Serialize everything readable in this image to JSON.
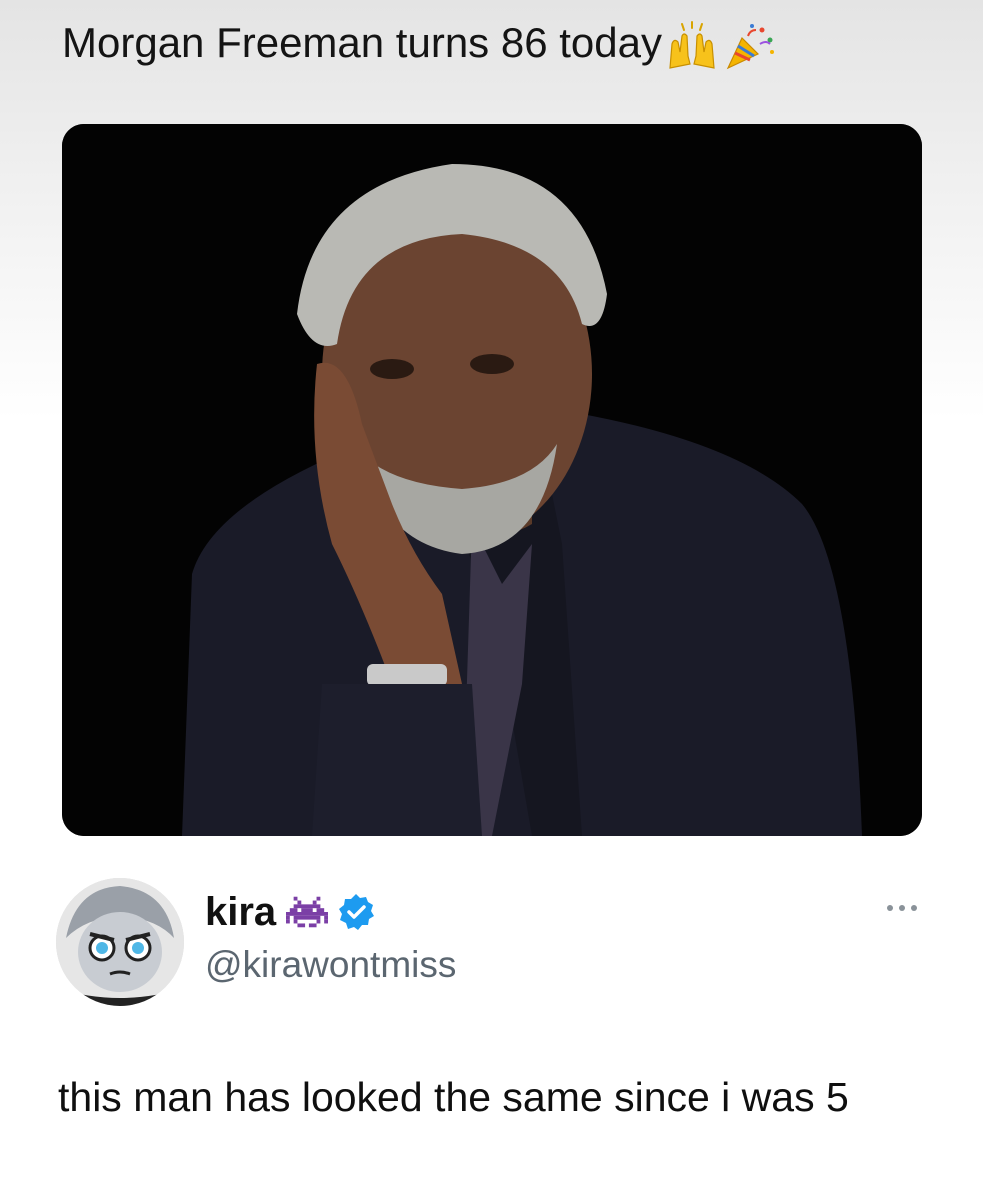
{
  "meme": {
    "headline": "Morgan Freeman turns 86 today",
    "headline_emojis": [
      "raising-hands-emoji",
      "party-popper-emoji"
    ]
  },
  "tweet": {
    "display_name": "kira",
    "handle": "@kirawontmiss",
    "verified": true,
    "name_emoji": "alien-monster-icon",
    "text": "this man has looked the same since i was 5",
    "more_icon": "more-options-icon"
  },
  "colors": {
    "verified_blue": "#1d9bf0",
    "alien_purple": "#7b3fa6",
    "handle_gray": "#5b6670"
  }
}
